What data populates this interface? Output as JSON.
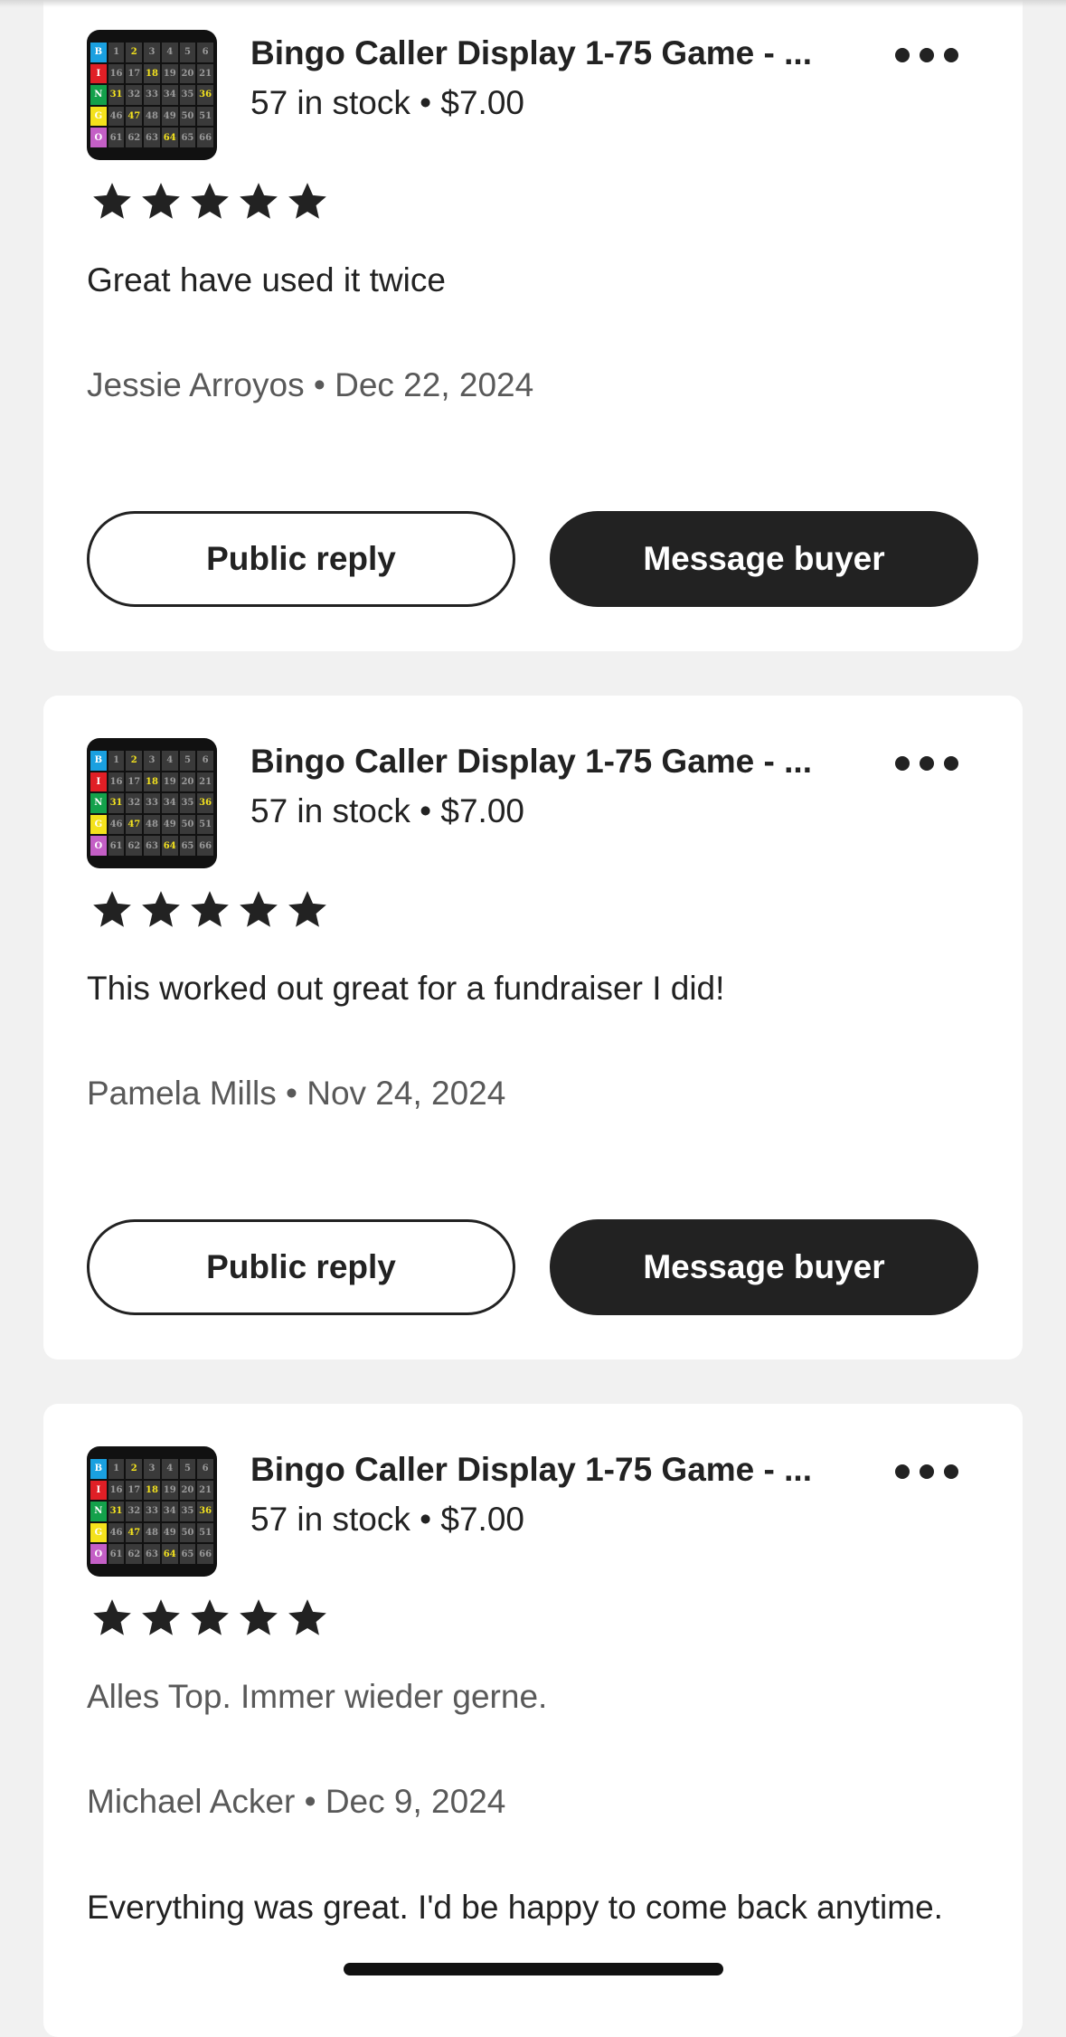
{
  "thumb": {
    "rows": [
      [
        "B",
        "1",
        "2",
        "3",
        "4",
        "5",
        "6"
      ],
      [
        "I",
        "16",
        "17",
        "18",
        "19",
        "20",
        "21"
      ],
      [
        "N",
        "31",
        "32",
        "33",
        "34",
        "35",
        "36"
      ],
      [
        "G",
        "46",
        "47",
        "48",
        "49",
        "50",
        "51"
      ],
      [
        "O",
        "61",
        "62",
        "63",
        "64",
        "65",
        "66"
      ]
    ],
    "header_colors": [
      "#1aa0e0",
      "#e01f26",
      "#14a14b",
      "#f4e21c",
      "#c45fc6"
    ],
    "highlighted": [
      "2",
      "18",
      "31",
      "36",
      "47",
      "64"
    ]
  },
  "reviews": [
    {
      "title": "Bingo Caller Display 1-75 Game - ...",
      "stock": "57 in stock • $7.00",
      "rating": 5,
      "text": "Great have used it twice",
      "meta": "Jessie Arroyos • Dec 22, 2024",
      "public_reply": "Public reply",
      "message_buyer": "Message buyer"
    },
    {
      "title": "Bingo Caller Display 1-75 Game - ...",
      "stock": "57 in stock • $7.00",
      "rating": 5,
      "text": "This worked out great for a fundraiser I did!",
      "meta": "Pamela Mills • Nov 24, 2024",
      "public_reply": "Public reply",
      "message_buyer": "Message buyer"
    },
    {
      "title": "Bingo Caller Display 1-75 Game - ...",
      "stock": "57 in stock • $7.00",
      "rating": 5,
      "text": "Alles Top. Immer wieder gerne.",
      "meta": "Michael Acker • Dec 9, 2024",
      "translation": "Everything was great. I'd be happy to come back anytime."
    }
  ],
  "colors": {
    "background": "#f1f1f1",
    "card": "#ffffff",
    "primary": "#222222",
    "muted": "#595959"
  }
}
